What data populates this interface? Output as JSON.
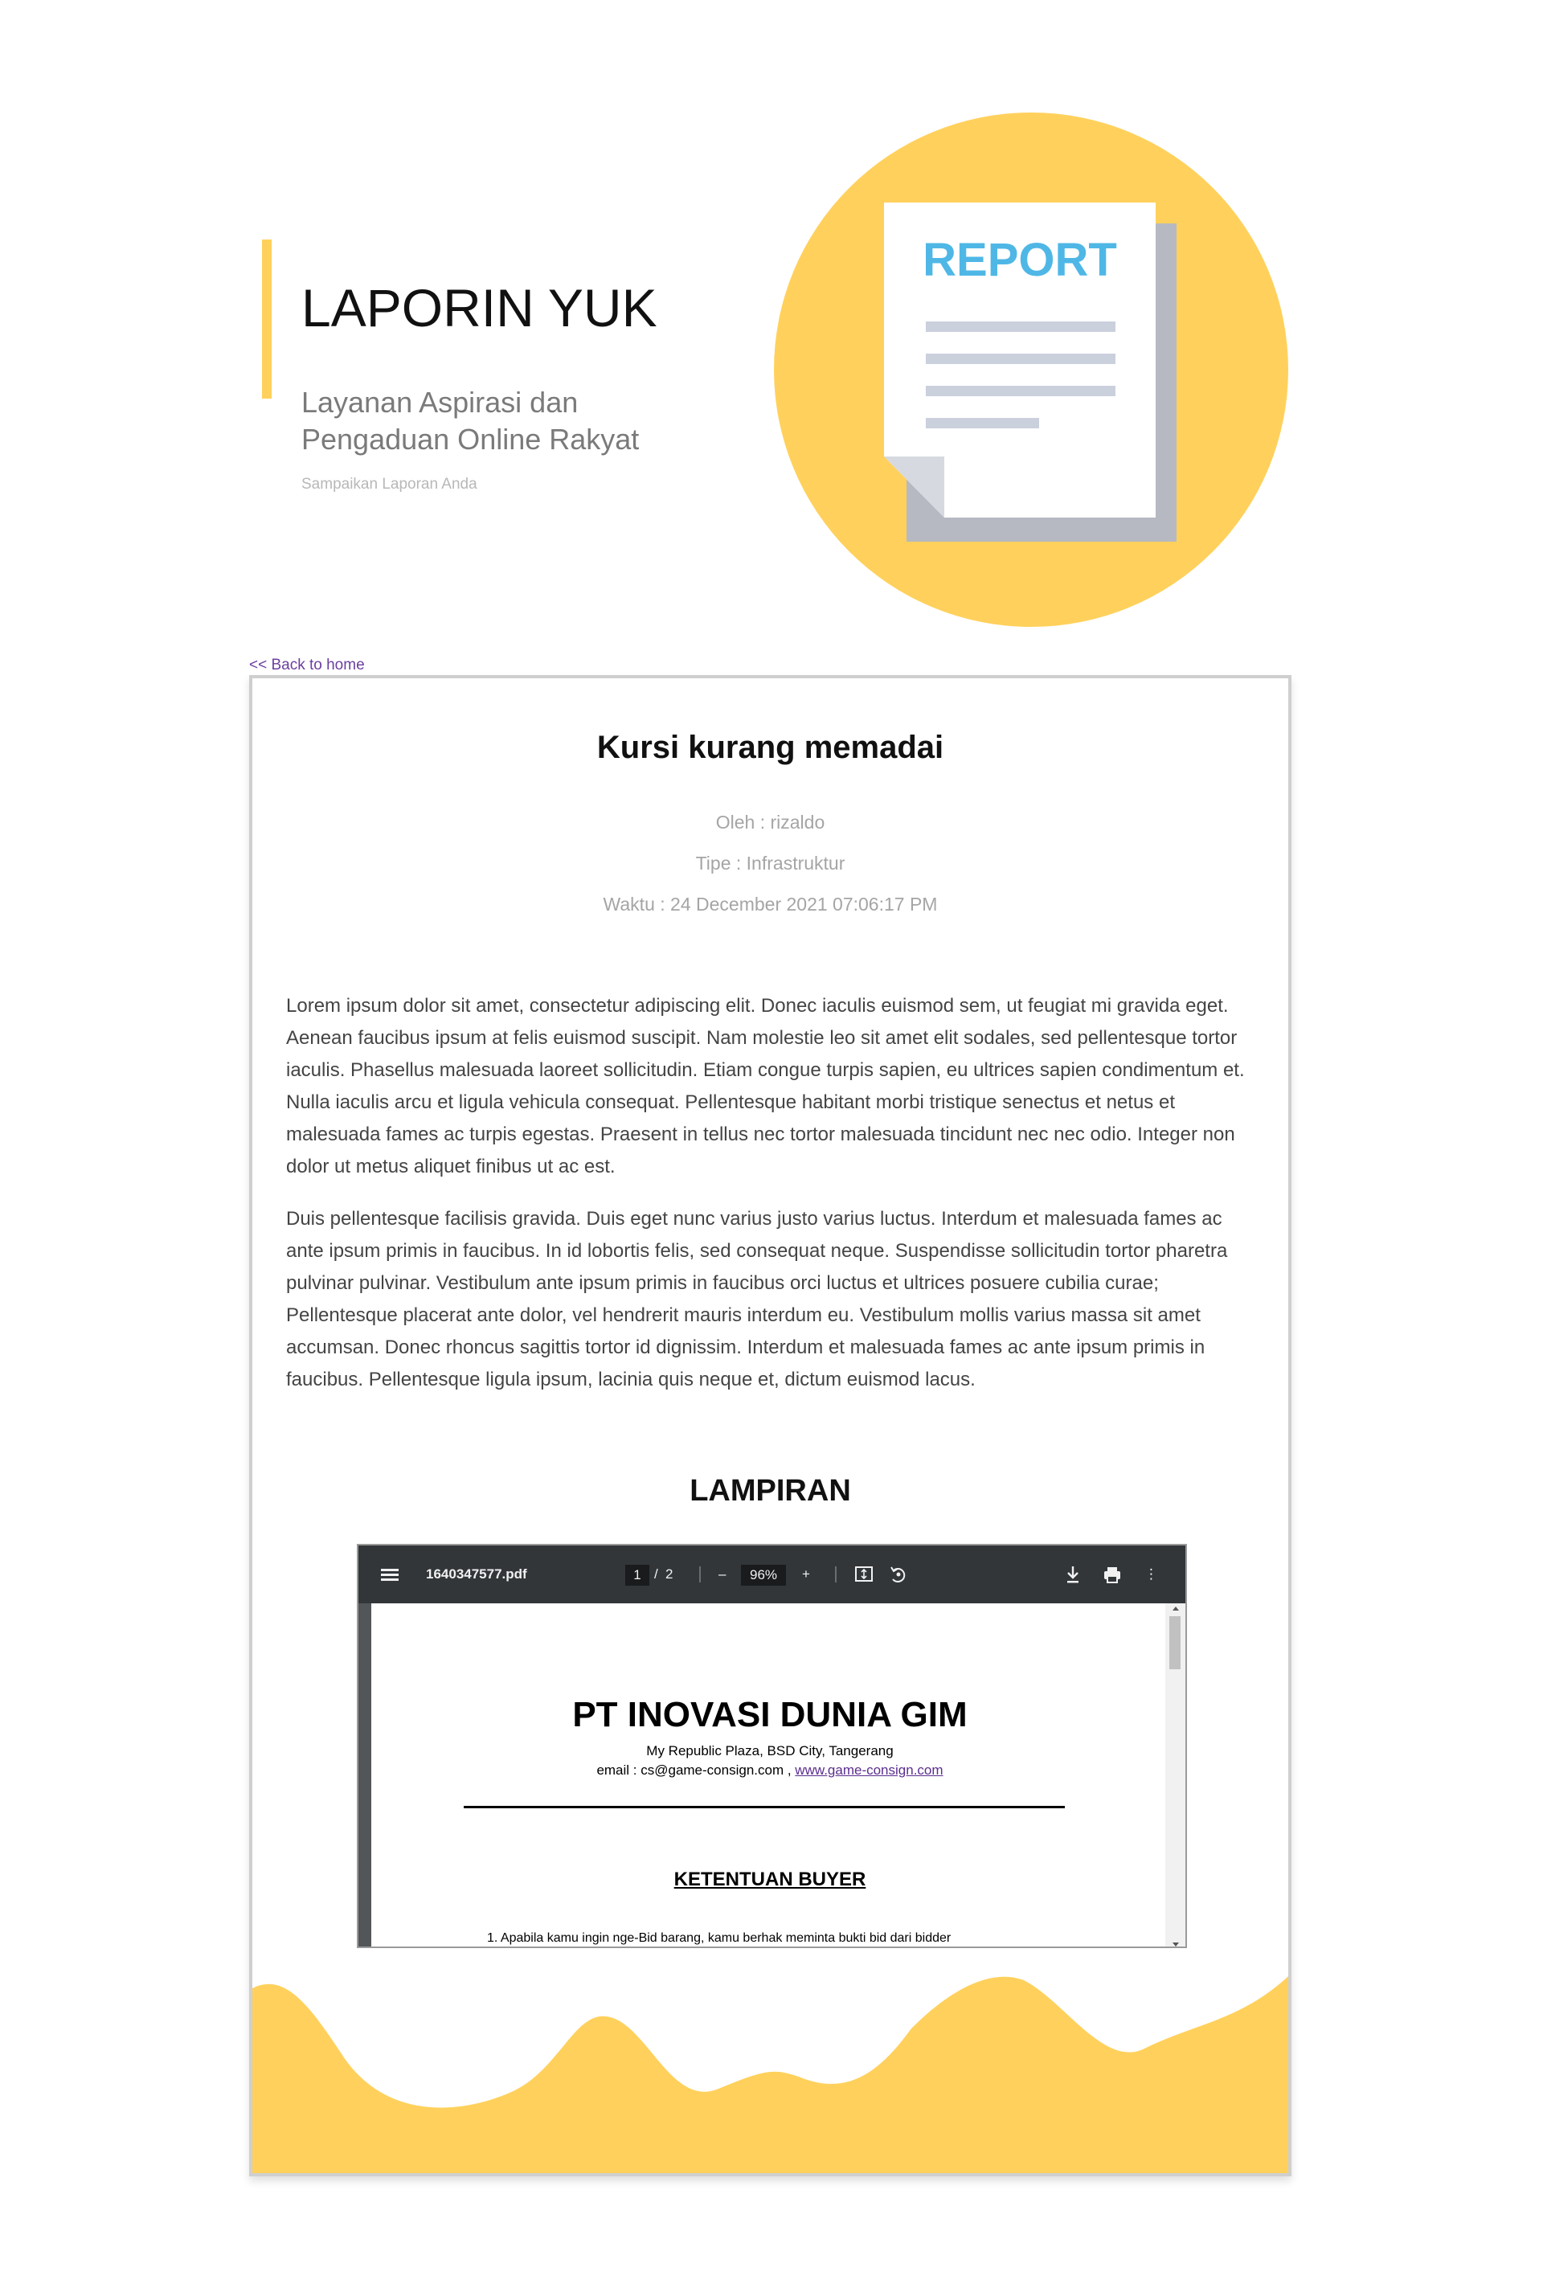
{
  "hero": {
    "title": "LAPORIN YUK",
    "subtitle": "Layanan Aspirasi dan Pengaduan Online Rakyat",
    "tagline": "Sampaikan Laporan Anda",
    "illustration_text": "REPORT",
    "accent_color": "#ffd15c",
    "report_text_color": "#4fb7e6"
  },
  "nav": {
    "back_link": "<< Back to home"
  },
  "report": {
    "title": "Kursi kurang memadai",
    "by": "Oleh : rizaldo",
    "type": "Tipe : Infrastruktur",
    "time": "Waktu : 24 December 2021 07:06:17 PM",
    "paragraphs": [
      "Lorem ipsum dolor sit amet, consectetur adipiscing elit. Donec iaculis euismod sem, ut feugiat mi gravida eget. Aenean faucibus ipsum at felis euismod suscipit. Nam molestie leo sit amet elit sodales, sed pellentesque tortor iaculis. Phasellus malesuada laoreet sollicitudin. Etiam congue turpis sapien, eu ultrices sapien condimentum et. Nulla iaculis arcu et ligula vehicula consequat. Pellentesque habitant morbi tristique senectus et netus et malesuada fames ac turpis egestas. Praesent in tellus nec tortor malesuada tincidunt nec nec odio. Integer non dolor ut metus aliquet finibus ut ac est.",
      "Duis pellentesque facilisis gravida. Duis eget nunc varius justo varius luctus. Interdum et malesuada fames ac ante ipsum primis in faucibus. In id lobortis felis, sed consequat neque. Suspendisse sollicitudin tortor pharetra pulvinar pulvinar. Vestibulum ante ipsum primis in faucibus orci luctus et ultrices posuere cubilia curae; Pellentesque placerat ante dolor, vel hendrerit mauris interdum eu. Vestibulum mollis varius massa sit amet accumsan. Donec rhoncus sagittis tortor id dignissim. Interdum et malesuada fames ac ante ipsum primis in faucibus. Pellentesque ligula ipsum, lacinia quis neque et, dictum euismod lacus."
    ],
    "attachment_heading": "LAMPIRAN"
  },
  "pdf": {
    "filename": "1640347577.pdf",
    "current_page": "1",
    "page_separator": "/",
    "total_pages": "2",
    "zoom": "96%",
    "minus": "–",
    "plus": "+",
    "more": "⋮",
    "icons": [
      "menu-icon",
      "fit-page-icon",
      "rotate-icon",
      "download-icon",
      "print-icon",
      "more-icon"
    ],
    "document": {
      "company": "PT INOVASI DUNIA GIM",
      "address": "My Republic Plaza, BSD City, Tangerang",
      "contact_prefix": "email : cs@game-consign.com ,",
      "contact_url": "www.game-consign.com",
      "heading": "KETENTUAN BUYER",
      "first_item": "1.   Apabila kamu ingin nge-Bid barang, kamu berhak meminta bukti bid dari bidder"
    }
  }
}
